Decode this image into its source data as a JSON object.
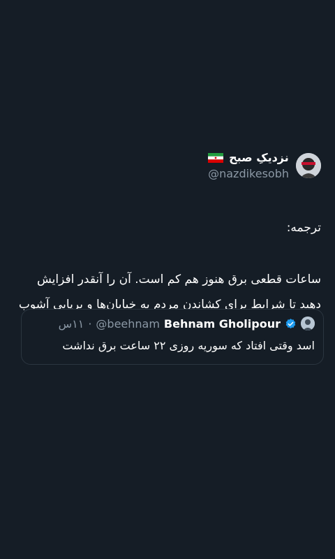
{
  "colors": {
    "background": "#151d26",
    "text_primary": "#ffffff",
    "text_secondary": "#8b98a5",
    "verified": "#1d9bf0",
    "border": "#2b3640"
  },
  "tweet": {
    "author_name": "نزدیکِ صبح",
    "author_handle": "@nazdikesobh",
    "label": "ترجمه:",
    "text": "ساعات قطعی برق هنوز هم کم است. آن را آنقدر افزایش دهید تا شرایط برای کشاندن مردم به خیابان‌ها و برپایی آشوب جهت براندازی فراهم شود."
  },
  "quoted": {
    "author_name": "Behnam Gholipour",
    "author_handle": "@beehnam",
    "time": "۱۱س",
    "separator": "·",
    "text": "اسد وقتی افتاد که سوریه روزی ۲۲ ساعت برق نداشت"
  },
  "icons": {
    "avatar": "avatar-image",
    "flag": "iran-flag-icon",
    "verified": "verified-badge-icon"
  }
}
